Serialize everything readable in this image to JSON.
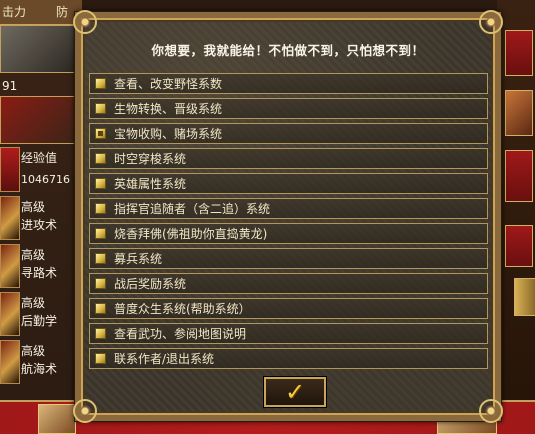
{
  "background": {
    "topbar": [
      "击力",
      "防"
    ],
    "stat_number_partial": "91",
    "experience_label": "经验值",
    "experience_value": "1046716",
    "skills": [
      {
        "line1": "高级",
        "line2": "进攻术"
      },
      {
        "line1": "高级",
        "line2": "寻路术"
      },
      {
        "line1": "高级",
        "line2": "后勤学"
      },
      {
        "line1": "高级",
        "line2": "航海术"
      }
    ]
  },
  "dialog": {
    "title": "你想要，我就能给！不怕做不到，只怕想不到！",
    "options": [
      {
        "label": "查看、改变野怪系数",
        "checked": false
      },
      {
        "label": "生物转换、晋级系统",
        "checked": false
      },
      {
        "label": "宝物收购、赌场系统",
        "checked": true
      },
      {
        "label": "时空穿梭系统",
        "checked": false
      },
      {
        "label": "英雄属性系统",
        "checked": false
      },
      {
        "label": "指挥官追随者（含二追）系统",
        "checked": false
      },
      {
        "label": "烧香拜佛(佛祖助你直捣黄龙)",
        "checked": false
      },
      {
        "label": "募兵系统",
        "checked": false
      },
      {
        "label": "战后奖励系统",
        "checked": false
      },
      {
        "label": "普度众生系统(帮助系统）",
        "checked": false
      },
      {
        "label": "查看武功、参阅地图说明",
        "checked": false
      },
      {
        "label": "联系作者/退出系统",
        "checked": false
      }
    ],
    "ok_icon": "checkmark-icon"
  }
}
